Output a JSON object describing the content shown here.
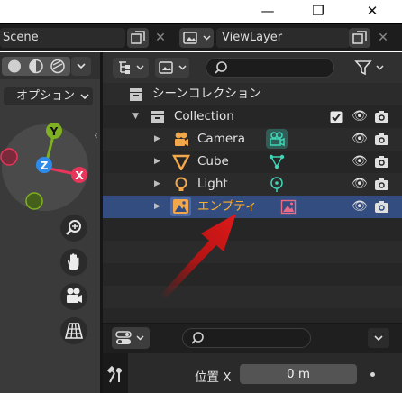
{
  "window": {
    "minimize_glyph": "—",
    "maximize_glyph": "❐",
    "close_glyph": "✕"
  },
  "header": {
    "scene_label": "Scene",
    "view_layer_label": "ViewLayer"
  },
  "outliner": {
    "scene_collection_label": "シーンコレクション",
    "rows": [
      {
        "label": "Collection",
        "icon": "collection-icon"
      },
      {
        "label": "Camera",
        "icon": "camera-icon",
        "data_icon": "camera-data-icon"
      },
      {
        "label": "Cube",
        "icon": "mesh-icon",
        "data_icon": "mesh-data-icon"
      },
      {
        "label": "Light",
        "icon": "light-icon",
        "data_icon": "light-data-icon"
      },
      {
        "label": "エンプティ",
        "icon": "empty-image-icon",
        "data_icon": "image-data-icon",
        "selected": true
      }
    ]
  },
  "viewport": {
    "options_label": "オプション",
    "gizmo_axes": {
      "x": "X",
      "y": "Y",
      "z": "Z"
    }
  },
  "properties": {
    "location_x_label": "位置 X",
    "location_x_value": "0 m"
  },
  "colors": {
    "selection": "#334d80",
    "active_text": "#ffaf29",
    "x_axis": "#e8365a",
    "y_axis": "#7fb022",
    "z_axis": "#2d8ceb",
    "annotation_arrow": "#d01010"
  }
}
